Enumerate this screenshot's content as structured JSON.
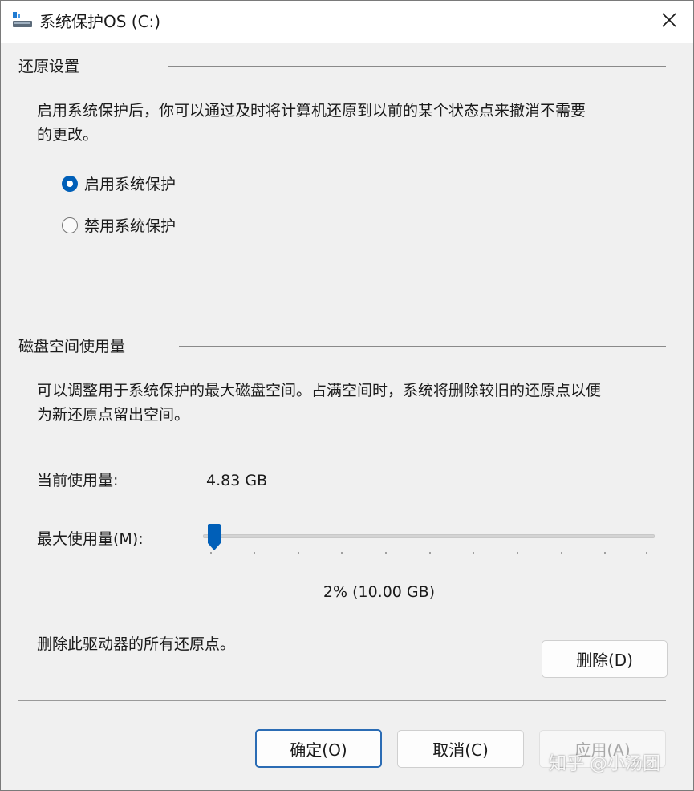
{
  "window": {
    "title": "系统保护OS (C:)",
    "close_icon": "close-icon",
    "app_icon": "system-drive-icon"
  },
  "restore_settings": {
    "title": "还原设置",
    "description_line1": "启用系统保护后，你可以通过及时将计算机还原到以前的某个状态点来撤消不需要",
    "description_line2": "的更改。",
    "options": [
      {
        "label": "启用系统保护",
        "selected": true
      },
      {
        "label": "禁用系统保护",
        "selected": false
      }
    ]
  },
  "disk_usage": {
    "title": "磁盘空间使用量",
    "description_line1": "可以调整用于系统保护的最大磁盘空间。占满空间时，系统将删除较旧的还原点以便",
    "description_line2": "为新还原点留出空间。",
    "current_label": "当前使用量:",
    "current_value": "4.83 GB",
    "max_label": "最大使用量(M):",
    "max_percent": 2,
    "max_value_text": "2% (10.00 GB)",
    "delete_description": "删除此驱动器的所有还原点。",
    "delete_button": "删除(D)"
  },
  "footer": {
    "ok_button": "确定(O)",
    "cancel_button": "取消(C)",
    "apply_button": "应用(A)",
    "apply_disabled": true
  },
  "watermark": "知乎 @小汤团",
  "colors": {
    "accent": "#005fb8",
    "background": "#f0f0f0",
    "titlebar": "#ffffff"
  }
}
